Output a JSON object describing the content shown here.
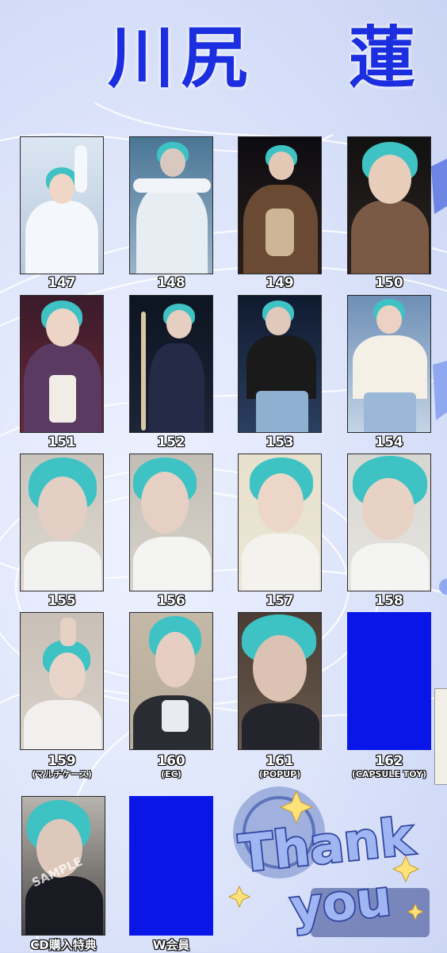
{
  "title": {
    "family_name": "川尻",
    "given_name": "蓮"
  },
  "cards": [
    {
      "number": "147",
      "subtitle": ""
    },
    {
      "number": "148",
      "subtitle": ""
    },
    {
      "number": "149",
      "subtitle": ""
    },
    {
      "number": "150",
      "subtitle": ""
    },
    {
      "number": "151",
      "subtitle": ""
    },
    {
      "number": "152",
      "subtitle": ""
    },
    {
      "number": "153",
      "subtitle": ""
    },
    {
      "number": "154",
      "subtitle": ""
    },
    {
      "number": "155",
      "subtitle": ""
    },
    {
      "number": "156",
      "subtitle": ""
    },
    {
      "number": "157",
      "subtitle": ""
    },
    {
      "number": "158",
      "subtitle": ""
    },
    {
      "number": "159",
      "subtitle": "(マルチケース)"
    },
    {
      "number": "160",
      "subtitle": "(EC)"
    },
    {
      "number": "161",
      "subtitle": "(POPUP)"
    },
    {
      "number": "162",
      "subtitle": "(CAPSULE TOY)"
    },
    {
      "number": "CD購入特典",
      "subtitle": ""
    },
    {
      "number": "W会員",
      "subtitle": ""
    }
  ],
  "watermark": "SAMPLE",
  "sticker": {
    "line1": "Thank",
    "line2": "you"
  },
  "colors": {
    "title": "#1b2ee0",
    "placeholder": "#0a16e8",
    "hair": "#3ec2c4",
    "sticker": "#8fa8f0"
  }
}
